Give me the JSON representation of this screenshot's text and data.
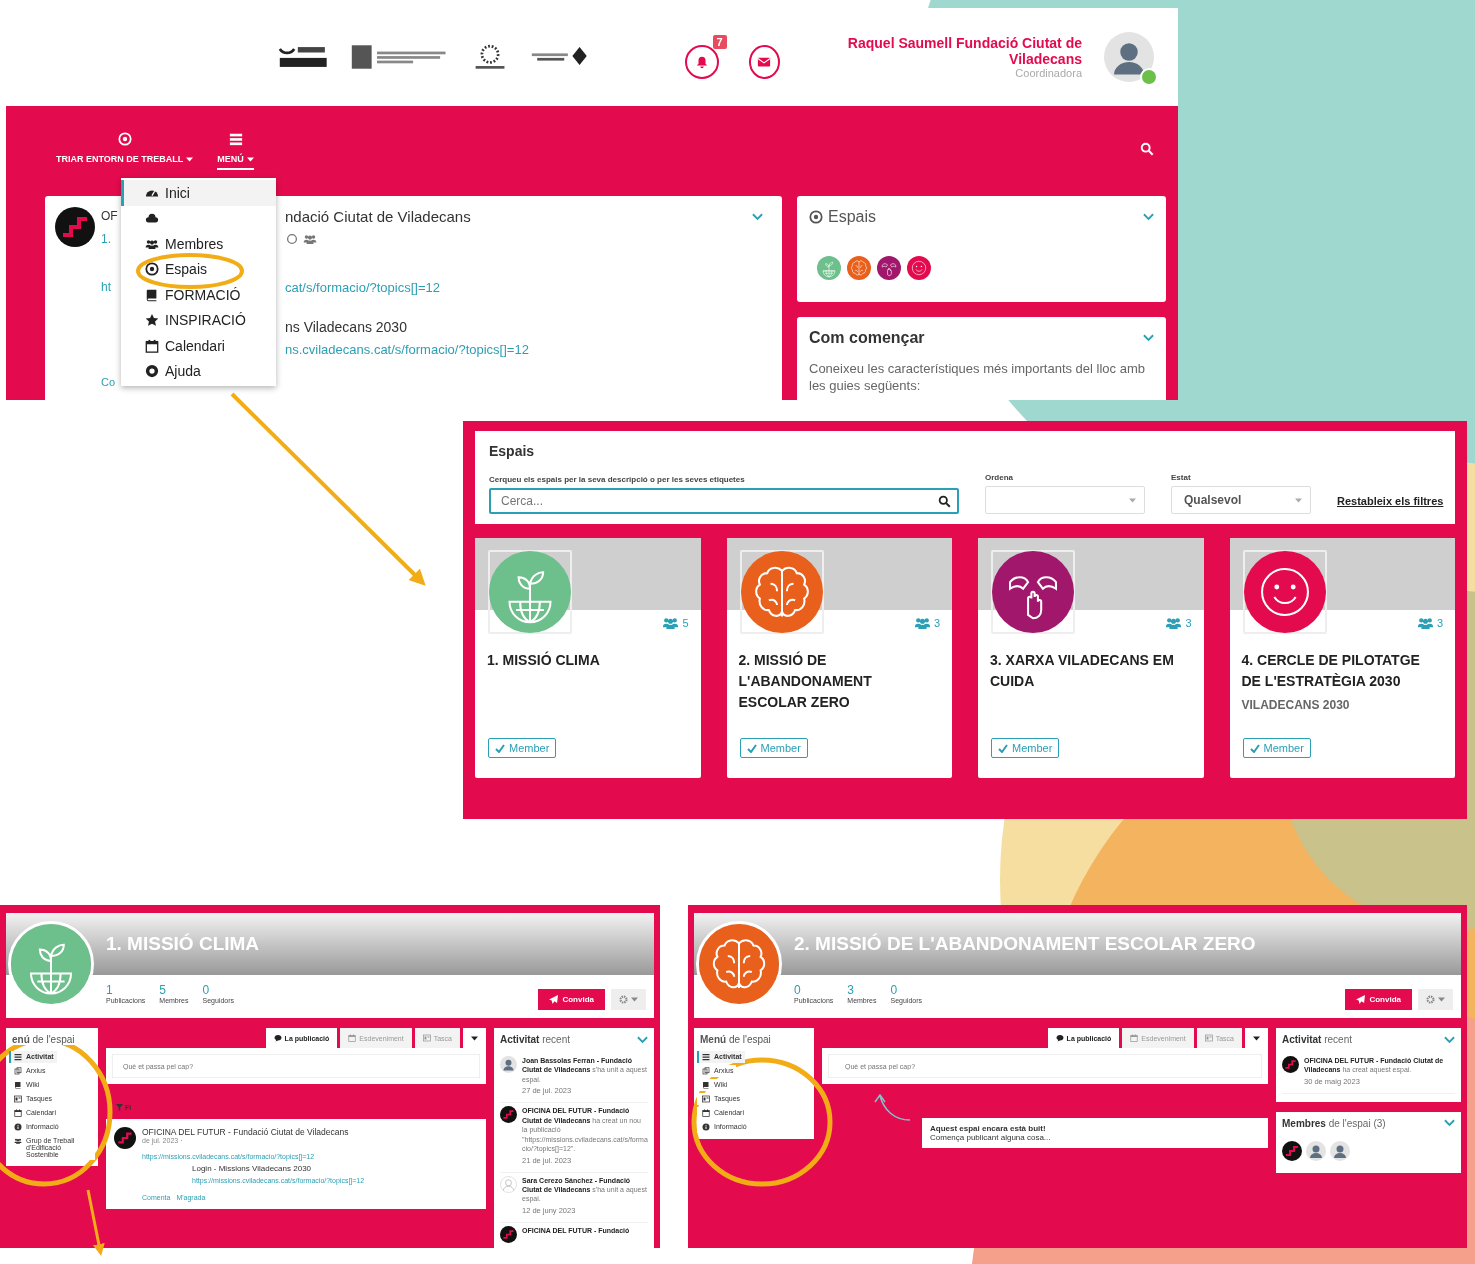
{
  "top_screen": {
    "notification_count": "7",
    "user": {
      "name": "Raquel Saumell Fundació Ciutat de Viladecans",
      "role": "Coordinadora"
    },
    "nav": [
      {
        "label": "TRIAR ENTORN DE TREBALL",
        "selected": false
      },
      {
        "label": "MENÚ",
        "selected": true
      }
    ],
    "dropdown": [
      {
        "label": "Inici",
        "selected": true
      },
      {
        "selected": false
      },
      {
        "label": "Membres",
        "selected": false
      },
      {
        "label": "Espais",
        "selected": false
      },
      {
        "label": "FORMACIÓ",
        "selected": false
      },
      {
        "label": "INSPIRACIÓ",
        "selected": false
      },
      {
        "label": "Calendari",
        "selected": false
      },
      {
        "label": "Ajuda",
        "selected": false
      }
    ],
    "post": {
      "left_fragments": [
        "OF",
        "1.",
        "ht",
        "Co"
      ],
      "title": "ndació Ciutat de Viladecans",
      "link": "cat/s/formacio/?topics[]=12",
      "preview_title": "ns Viladecans 2030",
      "preview_link": "ns.cviladecans.cat/s/formacio/?topics[]=12"
    },
    "spaces_widget": {
      "title": "Espais",
      "spaces": [
        {
          "color": "#6dbf8b"
        },
        {
          "color": "#e8601c"
        },
        {
          "color": "#a0176b"
        },
        {
          "color": "#e30b4e"
        }
      ]
    },
    "getting_started": {
      "title": "Com començar",
      "text": "Coneixeu les característiques més importants del lloc amb les guies següents:"
    }
  },
  "spaces_directory": {
    "title": "Espais",
    "search": {
      "label": "Cerqueu els espais per la seva descripció o per les seves etiquetes",
      "placeholder": "Cerca..."
    },
    "sort": {
      "label": "Ordena"
    },
    "status": {
      "label": "Estat",
      "value": "Qualsevol"
    },
    "reset": "Restableix els filtres",
    "cards": [
      {
        "title": "1. MISSIÓ CLIMA",
        "members": "5",
        "color": "#6dbf8b",
        "badge": "Member"
      },
      {
        "title": "2. MISSIÓ DE L'ABANDONAMENT ESCOLAR ZERO",
        "members": "3",
        "color": "#e8601c",
        "badge": "Member"
      },
      {
        "title": "3. XARXA VILADECANS EM CUIDA",
        "members": "3",
        "color": "#a0176b",
        "badge": "Member"
      },
      {
        "title": "4. CERCLE DE PILOTATGE DE L'ESTRATÈGIA 2030",
        "subtitle": "VILADECANS 2030",
        "members": "3",
        "color": "#e30b4e",
        "badge": "Member"
      }
    ]
  },
  "space_pages": [
    {
      "title": "1. MISSIÓ CLIMA",
      "color": "#6dbf8b",
      "stats": [
        {
          "value": "1",
          "label": "Publicacions"
        },
        {
          "value": "5",
          "label": "Membres"
        },
        {
          "value": "0",
          "label": "Seguidors"
        }
      ],
      "invite": "Convida",
      "menu_title": "**enú** de l'espai",
      "menu": [
        {
          "label": "Activitat",
          "selected": true
        },
        {
          "label": "Arxius",
          "selected": false
        },
        {
          "label": "Wiki",
          "selected": false
        },
        {
          "label": "Tasques",
          "selected": false
        },
        {
          "label": "Calendari",
          "selected": false
        },
        {
          "label": "Informació",
          "selected": false
        },
        {
          "label": "Grup de Treball d'Edificació Sostenible",
          "selected": false
        }
      ],
      "tabs": [
        {
          "label": "La publicació",
          "selected": true
        },
        {
          "label": "Esdeveniment",
          "selected": false
        },
        {
          "label": "Tasca",
          "selected": false
        }
      ],
      "composer_placeholder": "Què et passa pel cap?",
      "filter": "Fi",
      "post": {
        "author": "OFICINA DEL FUTUR - Fundació Ciutat de Viladecans",
        "meta": "de jul. 2023 ·",
        "link": "https://missions.cviladecans.cat/s/formacio/?topics[]=12",
        "preview_title": "Login - Missions Viladecans 2030",
        "preview_link": "https://missions.cviladecans.cat/s/formacio/?topics[]=12",
        "actions": [
          "Comenta",
          "M'agrada"
        ]
      },
      "activity": {
        "title": "**Activitat** recent",
        "items": [
          {
            "kind": "person",
            "text": "**Joan Bassolas Ferran - Fundació Ciutat de Viladecans** s'ha unit a aquest espai.",
            "date": "27 de jul. 2023"
          },
          {
            "kind": "logo",
            "text": "**OFICINA DEL FUTUR - Fundació Ciutat de Viladecans** ha creat un nou la publicació \"https://missions.cviladecans.cat/s/formacio/?topics[]=12\".",
            "date": "21 de jul. 2023"
          },
          {
            "kind": "outline",
            "text": "**Sara Cerezo Sánchez - Fundació Ciutat de Viladecans** s'ha unit a aquest espai.",
            "date": "12 de juny 2023"
          },
          {
            "kind": "logo",
            "text": "**OFICINA DEL FUTUR - Fundació**"
          }
        ]
      }
    },
    {
      "title": "2. MISSIÓ DE L'ABANDONAMENT ESCOLAR ZERO",
      "color": "#e8601c",
      "stats": [
        {
          "value": "0",
          "label": "Publicacions"
        },
        {
          "value": "3",
          "label": "Membres"
        },
        {
          "value": "0",
          "label": "Seguidors"
        }
      ],
      "invite": "Convida",
      "menu_title": "**Menú** de l'espai",
      "menu": [
        {
          "label": "Activitat",
          "selected": true
        },
        {
          "label": "Arxius",
          "selected": false
        },
        {
          "label": "Wiki",
          "selected": false
        },
        {
          "label": "Tasques",
          "selected": false
        },
        {
          "label": "Calendari",
          "selected": false
        },
        {
          "label": "Informació",
          "selected": false
        }
      ],
      "tabs": [
        {
          "label": "La publicació",
          "selected": true
        },
        {
          "label": "Esdeveniment",
          "selected": false
        },
        {
          "label": "Tasca",
          "selected": false
        }
      ],
      "composer_placeholder": "Què et passa pel cap?",
      "empty_note": {
        "title": "Aquest espai encara està buit!",
        "text": "Comença publicant alguna cosa..."
      },
      "activity": {
        "title": "**Activitat** recent",
        "items": [
          {
            "kind": "logo",
            "text": "**OFICINA DEL FUTUR - Fundació Ciutat de Viladecans** ha creat aquest espai.",
            "date": "30 de maig 2023"
          }
        ]
      },
      "members": {
        "title": "**Membres** de l'espai (3)",
        "avatars": [
          {
            "kind": "logo"
          },
          {
            "kind": "person"
          },
          {
            "kind": "person"
          }
        ]
      }
    }
  ]
}
